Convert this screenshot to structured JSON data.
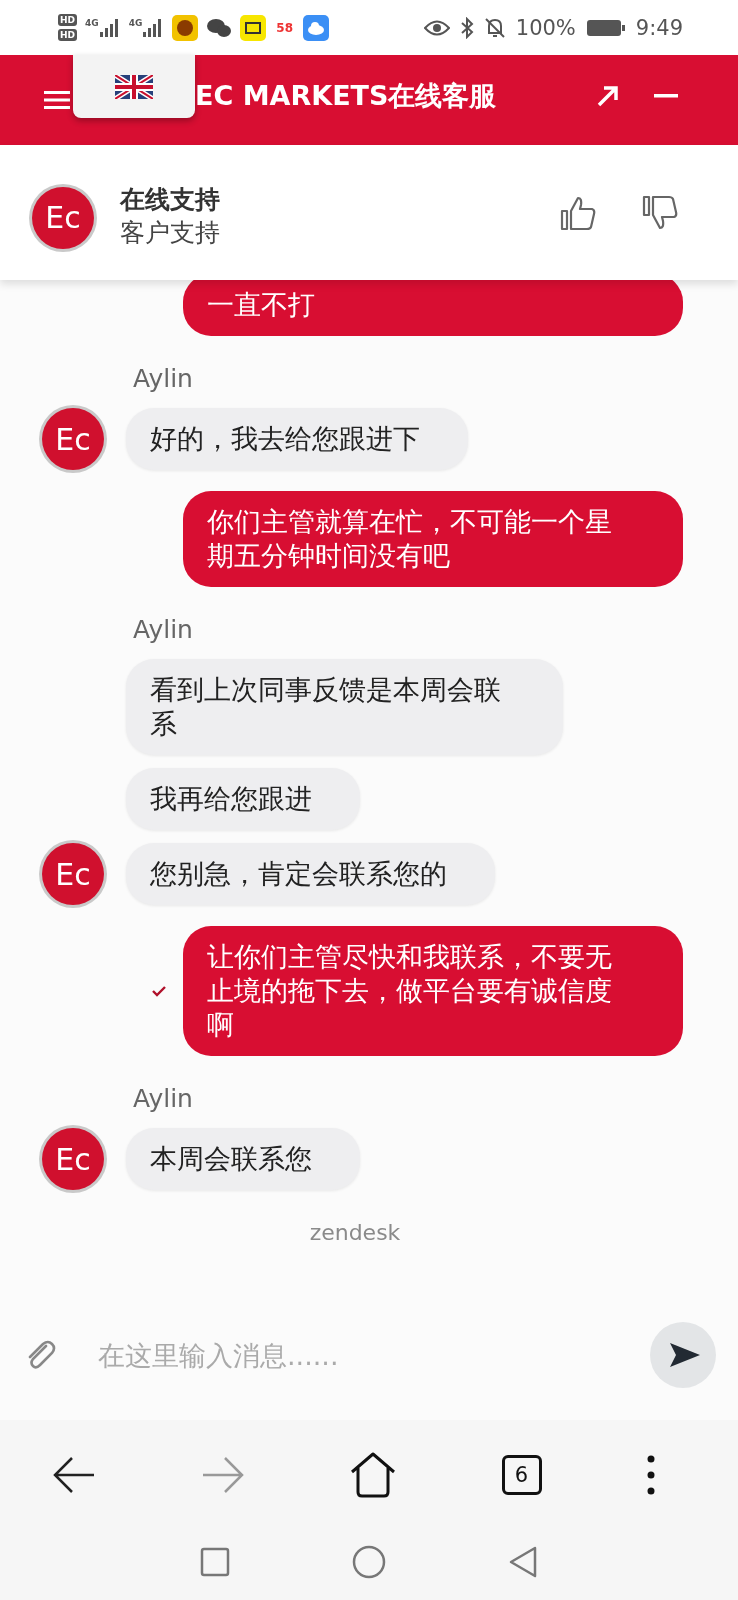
{
  "status_bar": {
    "sim_badges": [
      "HD",
      "HD"
    ],
    "networks": [
      "4G",
      "4G"
    ],
    "notification_apps": [
      {
        "kind": "logo",
        "color": "#f2c200"
      },
      {
        "kind": "chat"
      },
      {
        "kind": "reader",
        "color": "#f7e600"
      },
      {
        "kind": "badge",
        "label": "58"
      },
      {
        "kind": "cloud",
        "color": "#3b8ff5"
      }
    ],
    "battery": "100%",
    "time": "9:49"
  },
  "header": {
    "title": "EC MARKETS在线客服"
  },
  "agent_bar": {
    "logo": "Ec",
    "name": "在线支持",
    "subtitle": "客户支持"
  },
  "messages": [
    {
      "kind": "user",
      "text": "一直不打",
      "delivered": false
    },
    {
      "kind": "sender_name",
      "text": "Aylin"
    },
    {
      "kind": "agent",
      "text": "好的，我去给您跟进下",
      "avatar": "Ec"
    },
    {
      "kind": "user",
      "text": "你们主管就算在忙，不可能一个星期五分钟时间没有吧",
      "delivered": false
    },
    {
      "kind": "sender_name",
      "text": "Aylin"
    },
    {
      "kind": "agent",
      "text": "看到上次同事反馈是本周会联系"
    },
    {
      "kind": "agent",
      "text": "我再给您跟进"
    },
    {
      "kind": "agent",
      "text": "您别急，肯定会联系您的",
      "avatar": "Ec"
    },
    {
      "kind": "user",
      "text": "让你们主管尽快和我联系，不要无止境的拖下去，做平台要有诚信度啊",
      "delivered": true
    },
    {
      "kind": "sender_name",
      "text": "Aylin"
    },
    {
      "kind": "agent",
      "text": "本周会联系您",
      "avatar": "Ec"
    }
  ],
  "branding": "zendesk",
  "composer": {
    "placeholder": "在这里输入消息......"
  },
  "browser_nav": {
    "tab_count": "6",
    "forward_disabled": true
  }
}
